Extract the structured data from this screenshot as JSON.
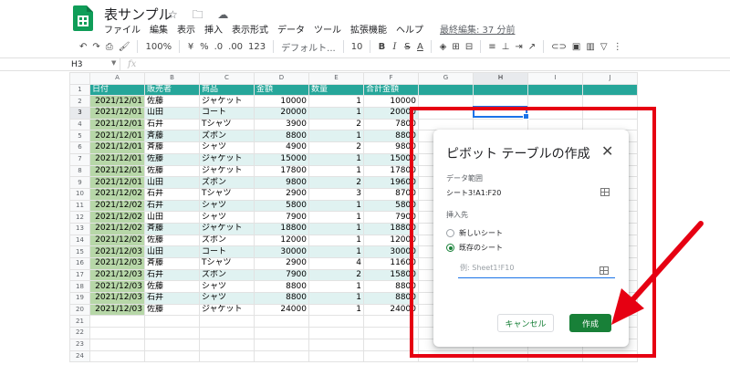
{
  "app": {
    "title": "表サンプル",
    "title_icons": "☆ 🗀 ☁",
    "last_edit": "最終編集: 37 分前",
    "colors": {
      "header_teal": "#26a69a",
      "band_teal": "#e0f2f1",
      "date_green": "#b7d7a8",
      "accent_green": "#188038",
      "annotation_red": "#e60012",
      "selection_blue": "#1a73e8"
    }
  },
  "menu": [
    "ファイル",
    "編集",
    "表示",
    "挿入",
    "表示形式",
    "データ",
    "ツール",
    "拡張機能",
    "ヘルプ"
  ],
  "toolbar": {
    "undo": "↶",
    "redo": "↷",
    "print": "⎙",
    "paint": "🖌",
    "zoom": "100%",
    "currency": "¥",
    "percent": "%",
    "dec_less": ".0",
    "dec_more": ".00",
    "more_formats": "123",
    "font": "デフォルト...",
    "font_size": "10",
    "bold": "B",
    "italic": "I",
    "strike": "S",
    "text_color": "A",
    "fill": "◈",
    "borders": "⊞",
    "merge": "⊟",
    "halign": "≡",
    "valign": "⊥",
    "wrap": "⇥",
    "rotate": "↗",
    "link": "⊂⊃",
    "comment": "▣",
    "chart": "▥",
    "filter": "▽",
    "more": "⋮"
  },
  "formula_bar": {
    "name_box": "H3",
    "fx": "fx"
  },
  "columns": [
    "A",
    "B",
    "C",
    "D",
    "E",
    "F",
    "G",
    "H",
    "I",
    "J"
  ],
  "table": {
    "headers": [
      "日付",
      "販売者",
      "商品",
      "金額",
      "数量",
      "合計金額"
    ],
    "rows": [
      [
        "2021/12/01",
        "佐藤",
        "ジャケット",
        "10000",
        "1",
        "10000"
      ],
      [
        "2021/12/01",
        "山田",
        "コート",
        "20000",
        "1",
        "20000"
      ],
      [
        "2021/12/01",
        "石井",
        "Tシャツ",
        "3900",
        "2",
        "7800"
      ],
      [
        "2021/12/01",
        "斉藤",
        "ズボン",
        "8800",
        "1",
        "8800"
      ],
      [
        "2021/12/01",
        "斉藤",
        "シャツ",
        "4900",
        "2",
        "9800"
      ],
      [
        "2021/12/01",
        "佐藤",
        "ジャケット",
        "15000",
        "1",
        "15000"
      ],
      [
        "2021/12/01",
        "佐藤",
        "ジャケット",
        "17800",
        "1",
        "17800"
      ],
      [
        "2021/12/01",
        "山田",
        "ズボン",
        "9800",
        "2",
        "19600"
      ],
      [
        "2021/12/02",
        "石井",
        "Tシャツ",
        "2900",
        "3",
        "8700"
      ],
      [
        "2021/12/02",
        "石井",
        "シャツ",
        "5800",
        "1",
        "5800"
      ],
      [
        "2021/12/02",
        "山田",
        "シャツ",
        "7900",
        "1",
        "7900"
      ],
      [
        "2021/12/02",
        "斉藤",
        "ジャケット",
        "18800",
        "1",
        "18800"
      ],
      [
        "2021/12/02",
        "佐藤",
        "ズボン",
        "12000",
        "1",
        "12000"
      ],
      [
        "2021/12/03",
        "山田",
        "コート",
        "30000",
        "1",
        "30000"
      ],
      [
        "2021/12/03",
        "斉藤",
        "Tシャツ",
        "2900",
        "4",
        "11600"
      ],
      [
        "2021/12/03",
        "石井",
        "ズボン",
        "7900",
        "2",
        "15800"
      ],
      [
        "2021/12/03",
        "佐藤",
        "シャツ",
        "8800",
        "1",
        "8800"
      ],
      [
        "2021/12/03",
        "石井",
        "シャツ",
        "8800",
        "1",
        "8800"
      ],
      [
        "2021/12/03",
        "佐藤",
        "ジャケット",
        "24000",
        "1",
        "24000"
      ]
    ],
    "empty_rows": [
      21,
      22,
      23,
      24
    ]
  },
  "dialog": {
    "title": "ピボット テーブルの作成",
    "close": "✕",
    "range_label": "データ範囲",
    "range_value": "シート3!A1:F20",
    "insert_label": "挿入先",
    "option_new": "新しいシート",
    "option_existing": "既存のシート",
    "selected_option": "既存のシート",
    "location_placeholder": "例: Sheet1!F10",
    "location_value": "",
    "cancel": "キャンセル",
    "create": "作成"
  }
}
